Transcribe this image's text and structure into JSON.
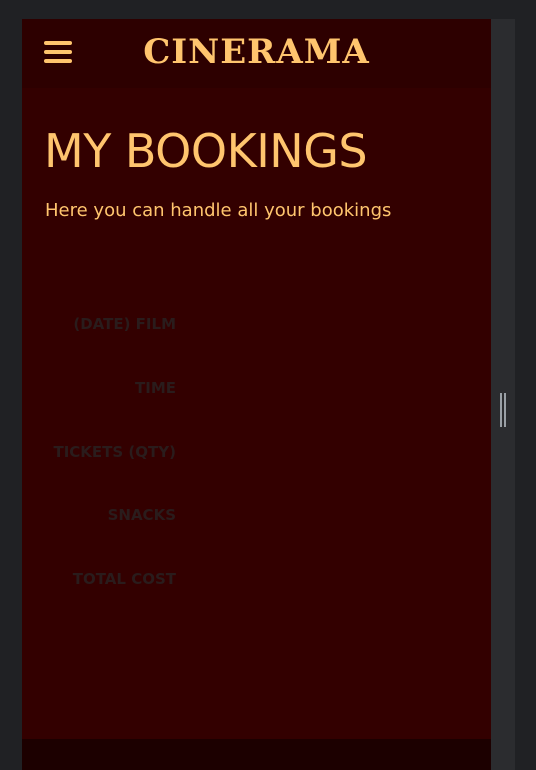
{
  "header": {
    "brand": "CINERAMA",
    "menu_icon": "hamburger-menu-icon"
  },
  "page": {
    "title": "MY BOOKINGS",
    "subtitle": "Here you can handle all your bookings"
  },
  "booking_summary": {
    "labels": [
      "(DATE) FILM",
      "TIME",
      "TICKETS (QTY)",
      "SNACKS",
      "TOTAL COST"
    ]
  },
  "colors": {
    "page_background": "#330000",
    "header_background": "#2d0000",
    "accent": "#ffc56e",
    "label_text": "#2a1c1c",
    "footer_background": "#1c0000"
  }
}
